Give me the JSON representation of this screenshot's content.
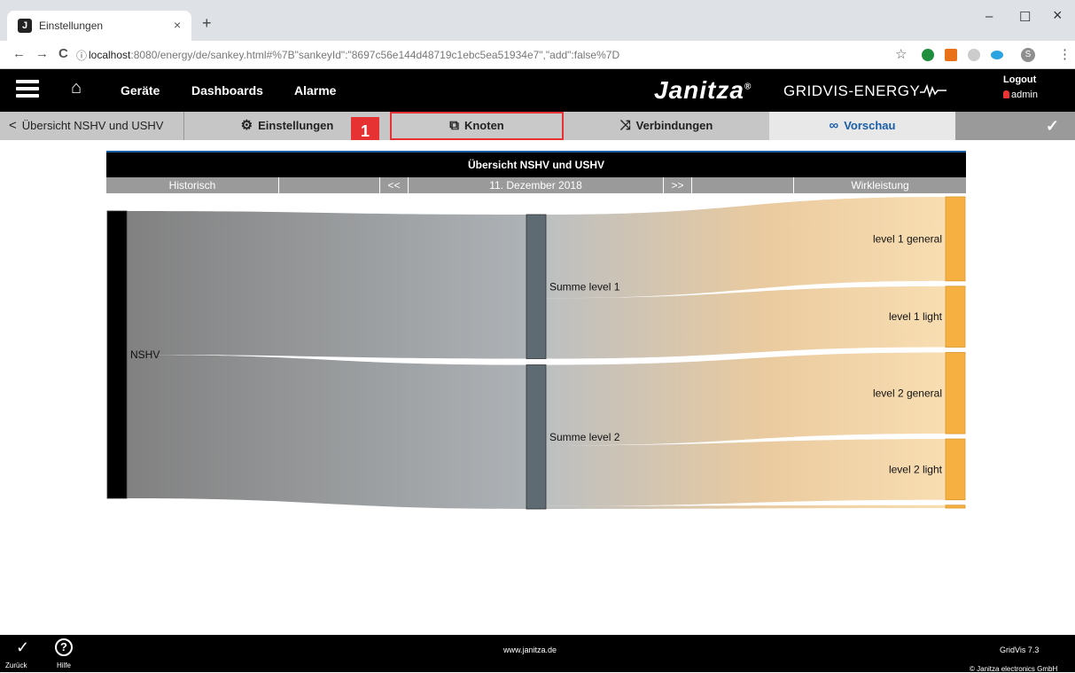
{
  "browser": {
    "tab_title": "Einstellungen",
    "tab_close": "×",
    "new_tab": "+",
    "url_host": "localhost",
    "url_path": ":8080/energy/de/sankey.html#%7B\"sankeyId\":\"8697c56e144d48719c1ebc5ea51934e7\",\"add\":false%7D",
    "minimize": "–",
    "maximize": "☐",
    "close": "×",
    "back": "←",
    "forward": "→",
    "reload": "C",
    "info": "ⓘ",
    "star": "☆",
    "profile_initial": "S",
    "menu": "⋮",
    "favicon_letter": "J"
  },
  "header": {
    "nav": [
      "Geräte",
      "Dashboards",
      "Alarme"
    ],
    "brand": "Janitza",
    "brand_reg": "®",
    "brand_sub": "GRIDVIS-ENERGY",
    "logout": "Logout",
    "user": "admin"
  },
  "toolbar": {
    "back_label": "Übersicht NSHV und USHV",
    "settings_label": "Einstellungen",
    "nodes_label": "Knoten",
    "connections_label": "Verbindungen",
    "preview_label": "Vorschau",
    "marker_number": "1"
  },
  "chart_bar": {
    "title": "Übersicht NSHV und USHV",
    "mode": "Historisch",
    "prev": "<<",
    "date": "11. Dezember 2018",
    "next": ">>",
    "measure": "Wirkleistung"
  },
  "chart_data": {
    "type": "sankey",
    "nodes": [
      {
        "name": "NSHV",
        "value": 100
      },
      {
        "name": "Summe level 1",
        "value": 50
      },
      {
        "name": "Summe level 2",
        "value": 50
      },
      {
        "name": "level 1 general",
        "value": 29
      },
      {
        "name": "level 1 light",
        "value": 21
      },
      {
        "name": "level 2 general",
        "value": 28
      },
      {
        "name": "level 2 light",
        "value": 21
      },
      {
        "name": "",
        "value": 1
      }
    ],
    "links": [
      {
        "source": "NSHV",
        "target": "Summe level 1",
        "value": 50
      },
      {
        "source": "NSHV",
        "target": "Summe level 2",
        "value": 50
      },
      {
        "source": "Summe level 1",
        "target": "level 1 general",
        "value": 29
      },
      {
        "source": "Summe level 1",
        "target": "level 1 light",
        "value": 21
      },
      {
        "source": "Summe level 2",
        "target": "level 2 general",
        "value": 28
      },
      {
        "source": "Summe level 2",
        "target": "level 2 light",
        "value": 21
      },
      {
        "source": "Summe level 2",
        "target": "",
        "value": 1
      }
    ],
    "colors": {
      "root": "#000000",
      "middle": "#5f6b73",
      "leaf": "#f5b041",
      "link_gray": "#8a8a8a",
      "link_orange": "#f8d9a6"
    }
  },
  "footer": {
    "back_label": "Zurück",
    "help_label": "Hilfe",
    "help_symbol": "?",
    "url": "www.janitza.de",
    "version": "GridVis 7.3",
    "copyright": "© Janitza electronics GmbH"
  }
}
